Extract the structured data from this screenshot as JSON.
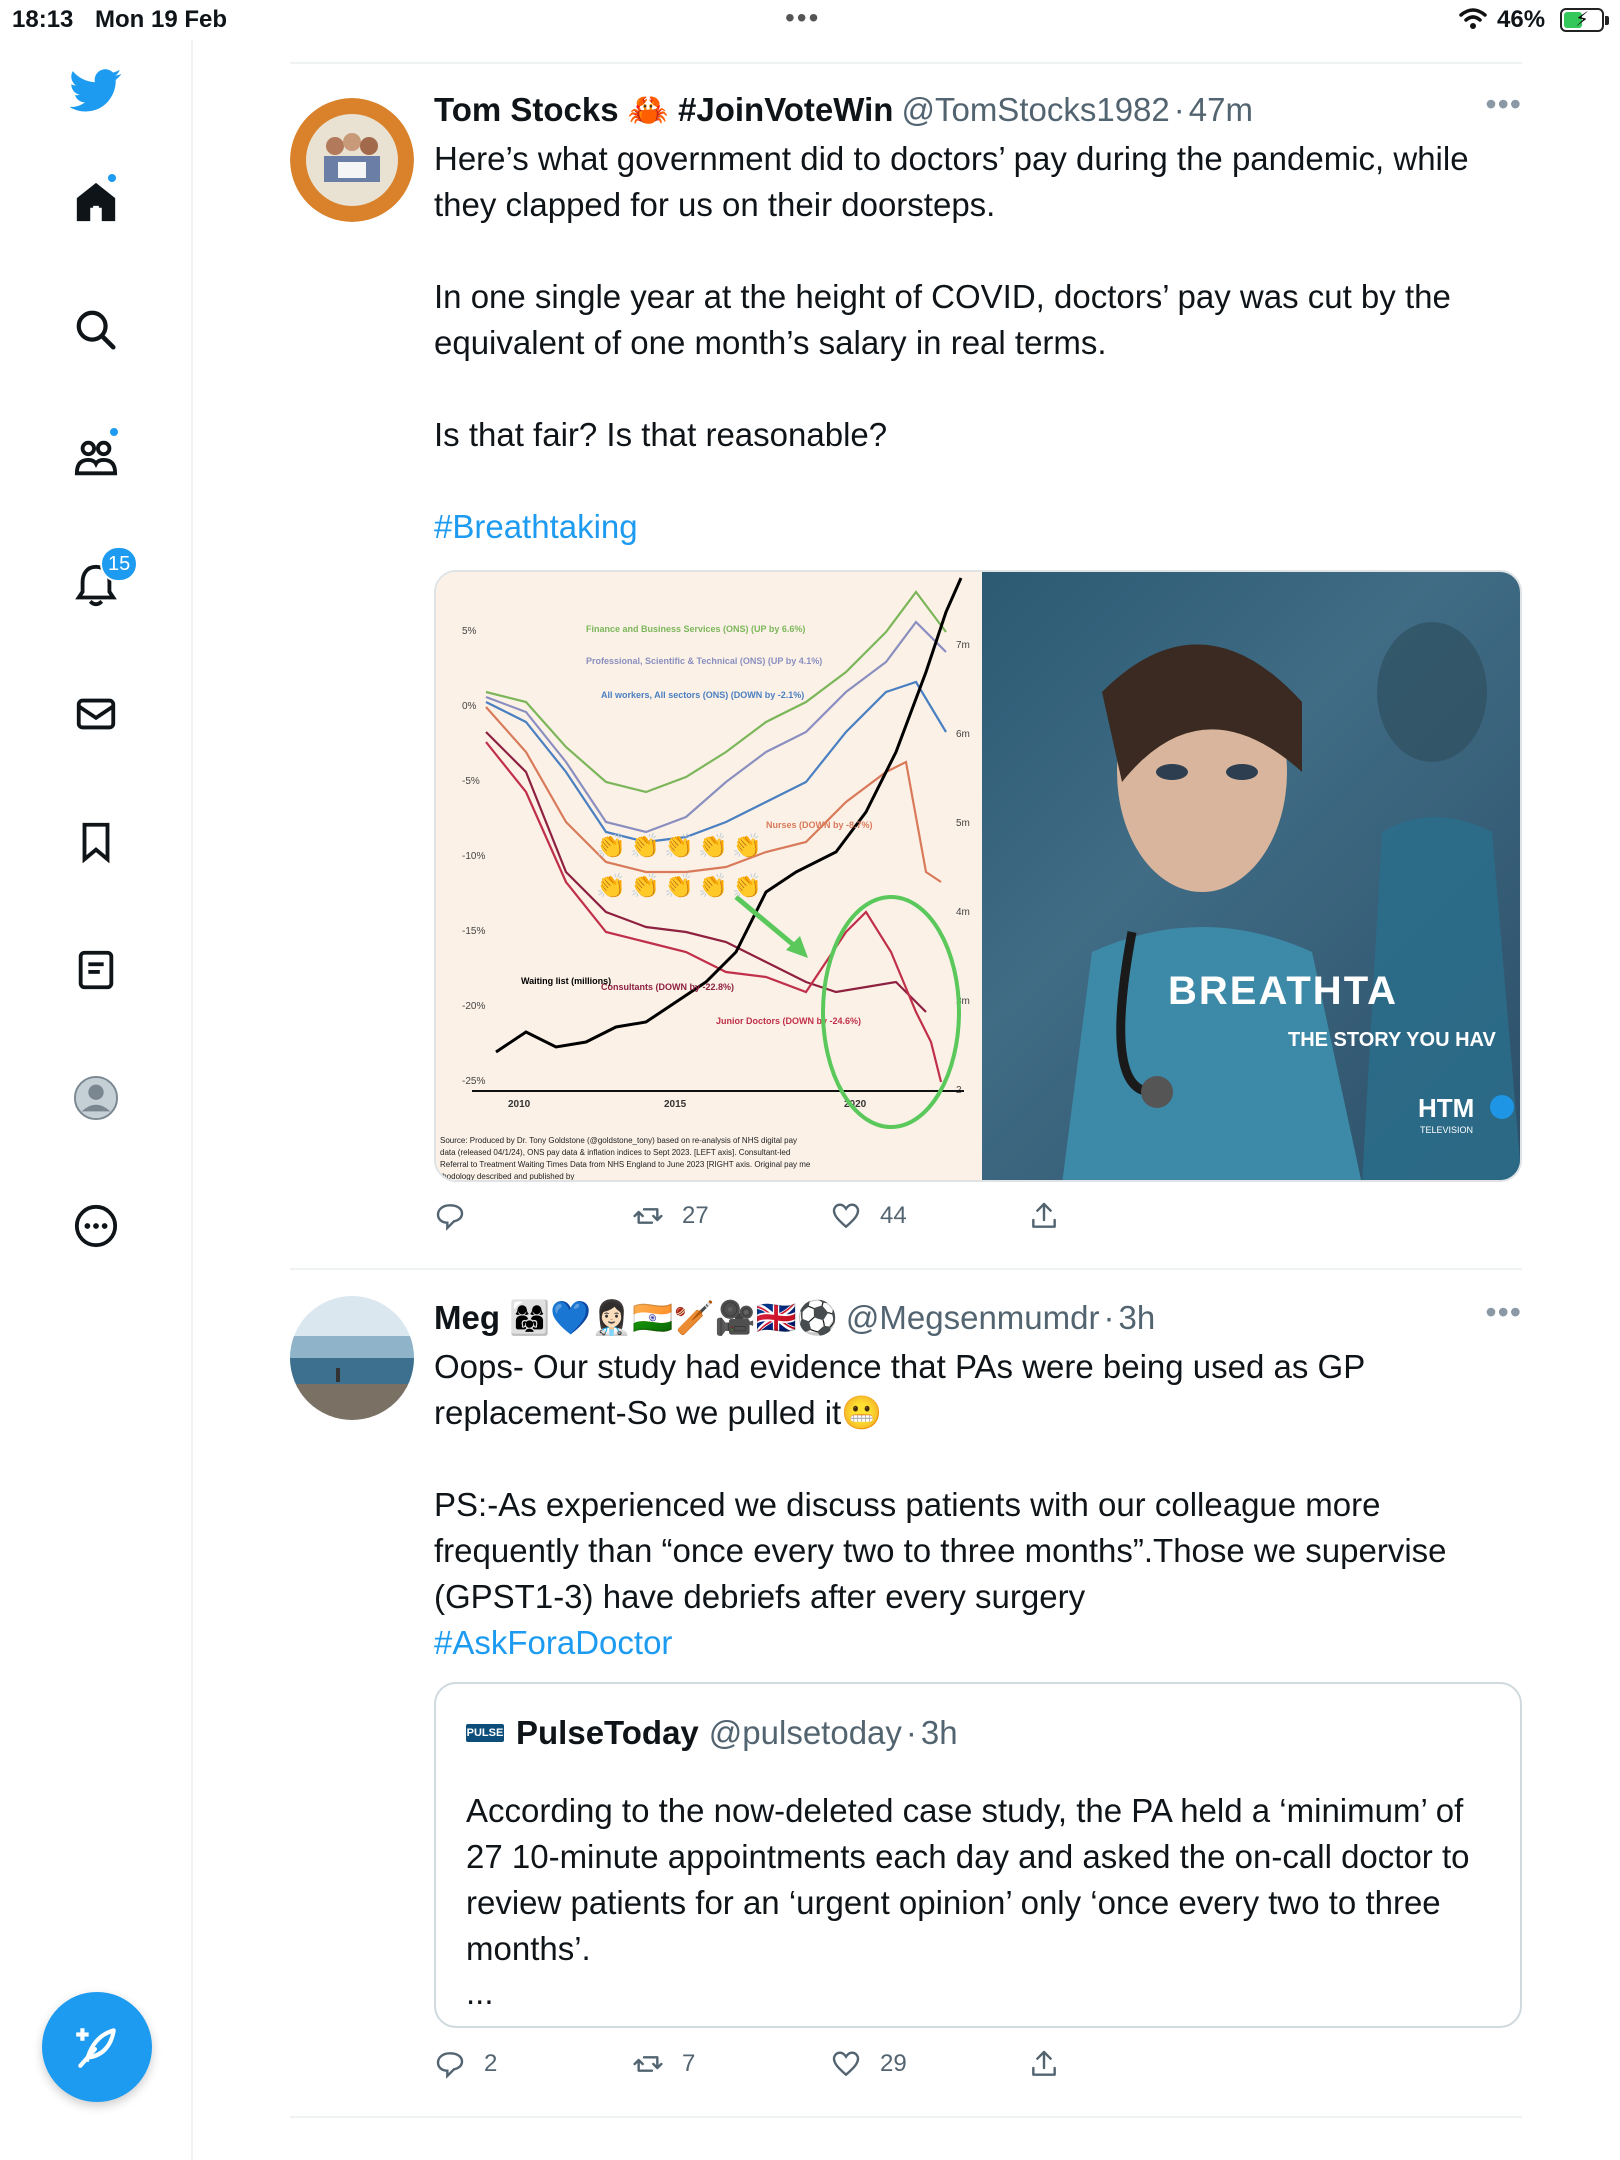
{
  "status_bar": {
    "time": "18:13",
    "date": "Mon 19 Feb",
    "battery": "46%"
  },
  "sidebar": {
    "notifications_badge": "15",
    "items": [
      "twitter-logo",
      "home-icon",
      "search-icon",
      "communities-icon",
      "notifications-icon",
      "messages-icon",
      "bookmarks-icon",
      "lists-icon",
      "profile-icon",
      "more-icon"
    ]
  },
  "tweets": [
    {
      "name": "Tom Stocks 🦀 #JoinVoteWin",
      "handle": "@TomStocks1982",
      "sep": "·",
      "ago": "47m",
      "paragraphs": [
        "Here’s what government did to doctors’ pay during the pandemic, while they clapped for us on their doorsteps.",
        "In one single year at the height of COVID, doctors’ pay was cut by the equivalent of one month’s salary in real terms.",
        "Is that fair? Is that reasonable?"
      ],
      "hashtag": "#Breathtaking",
      "replies": "",
      "retweets": "27",
      "likes": "44",
      "media_right": {
        "headline": "BREATHTA",
        "subline": "THE STORY YOU HAV",
        "brand": "HTM",
        "brand_sub": "TELEVISION"
      }
    },
    {
      "name": "Meg 👩‍👩‍👧💙👩🏻‍⚕️🇮🇳🏏🎥🇬🇧⚽",
      "handle": "@Megsenmumdr",
      "sep": "·",
      "ago": "3h",
      "line1": "Oops- Our study had evidence that PAs were being used as GP replacement-So we pulled it😬",
      "line2": "PS:-As experienced we discuss patients with our colleague more frequently than “once every two to three months”.Those we supervise (GPST1-3) have debriefs after every surgery",
      "hashtag": "#AskForaDoctor",
      "replies": "2",
      "retweets": "7",
      "likes": "29",
      "quote": {
        "logo": "PULSE",
        "name": "PulseToday",
        "handle": "@pulsetoday",
        "sep": "·",
        "ago": "3h",
        "text": "According to the now-deleted case study, the PA held a ‘minimum’ of 27 10-minute appointments each day and asked the on-call doctor to review patients for an ‘urgent opinion’ only ‘once every two to three months’.",
        "ellipsis": "..."
      }
    }
  ],
  "chart_data": {
    "type": "line",
    "y_left_ticks": [
      "5%",
      "0%",
      "-5%",
      "-10%",
      "-15%",
      "-20%",
      "-25%"
    ],
    "y_right_ticks": [
      "7m",
      "6m",
      "5m",
      "4m",
      "3m",
      "2"
    ],
    "x_ticks": [
      "2010",
      "2015",
      "2020"
    ],
    "ylim": [
      -25,
      5
    ],
    "legend": [
      {
        "name": "Finance and Business Services (ONS) (UP by 6.6%)",
        "color": "#7cb65a"
      },
      {
        "name": "Professional, Scientific & Technical (ONS) (UP by 4.1%)",
        "color": "#8a8fbf"
      },
      {
        "name": "All workers, All sectors (ONS) (DOWN by -2.1%)",
        "color": "#4a7fc1"
      },
      {
        "name": "Nurses (DOWN by -8.7%)",
        "color": "#d97a5a"
      },
      {
        "name": "Consultants (DOWN by -22.8%)",
        "color": "#8e2040"
      },
      {
        "name": "Junior Doctors (DOWN by -24.6%)",
        "color": "#c0304a"
      },
      {
        "name": "Waiting list (millions)",
        "color": "#000000"
      }
    ],
    "source": "Source: Produced by Dr. Tony Goldstone (@goldstone_tony) based on re-analysis of NHS digital pay data (released 04/1/24), ONS pay data & inflation indices to Sept 2023. [LEFT axis]. Consultant-led Referral to Treatment Waiting Times Data from NHS England to June 2023 [RIGHT axis. Original pay methodology described and published by"
  }
}
